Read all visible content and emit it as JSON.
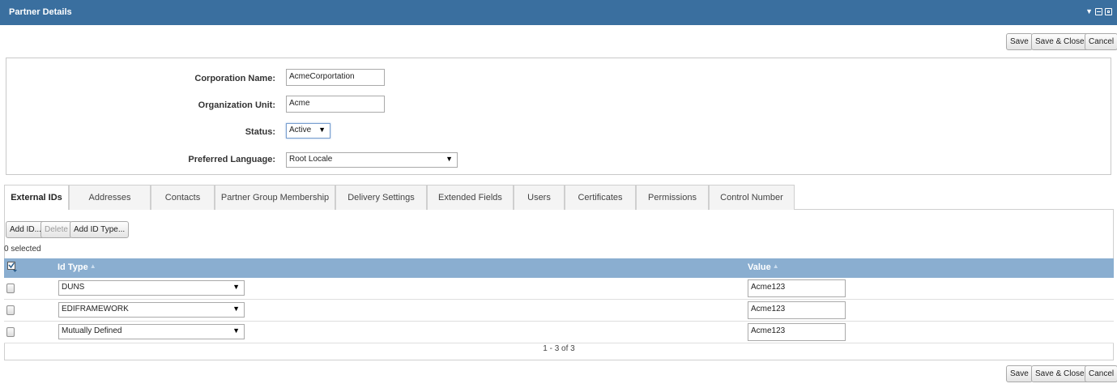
{
  "window": {
    "title": "Partner Details",
    "controls": [
      "dropdown-icon",
      "minimize-icon",
      "popout-icon"
    ]
  },
  "toolbar": {
    "save_label": "Save",
    "save_close_label": "Save & Close",
    "cancel_label": "Cancel"
  },
  "form": {
    "corporation_name": {
      "label": "Corporation Name:",
      "value": "AcmeCorportation"
    },
    "organization_unit": {
      "label": "Organization Unit:",
      "value": "Acme"
    },
    "status": {
      "label": "Status:",
      "value": "Active"
    },
    "preferred_language": {
      "label": "Preferred Language:",
      "value": "Root Locale"
    }
  },
  "tabs": [
    {
      "label": "External IDs",
      "active": true
    },
    {
      "label": "Addresses"
    },
    {
      "label": "Contacts"
    },
    {
      "label": "Partner Group Membership"
    },
    {
      "label": "Delivery Settings"
    },
    {
      "label": "Extended Fields"
    },
    {
      "label": "Users"
    },
    {
      "label": "Certificates"
    },
    {
      "label": "Permissions"
    },
    {
      "label": "Control Number"
    }
  ],
  "grid_toolbar": {
    "add_id_label": "Add ID...",
    "delete_label": "Delete",
    "add_id_type_label": "Add ID Type..."
  },
  "selection": {
    "count_text": "0 selected"
  },
  "grid": {
    "columns": {
      "id_type": "Id Type",
      "value": "Value"
    },
    "rows": [
      {
        "id_type": "DUNS",
        "value": "Acme123"
      },
      {
        "id_type": "EDIFRAMEWORK",
        "value": "Acme123"
      },
      {
        "id_type": "Mutually Defined",
        "value": "Acme123"
      }
    ],
    "pager_text": "1 - 3 of 3"
  },
  "colors": {
    "titlebar": "#3a6f9f",
    "grid_header": "#8aaed0"
  }
}
